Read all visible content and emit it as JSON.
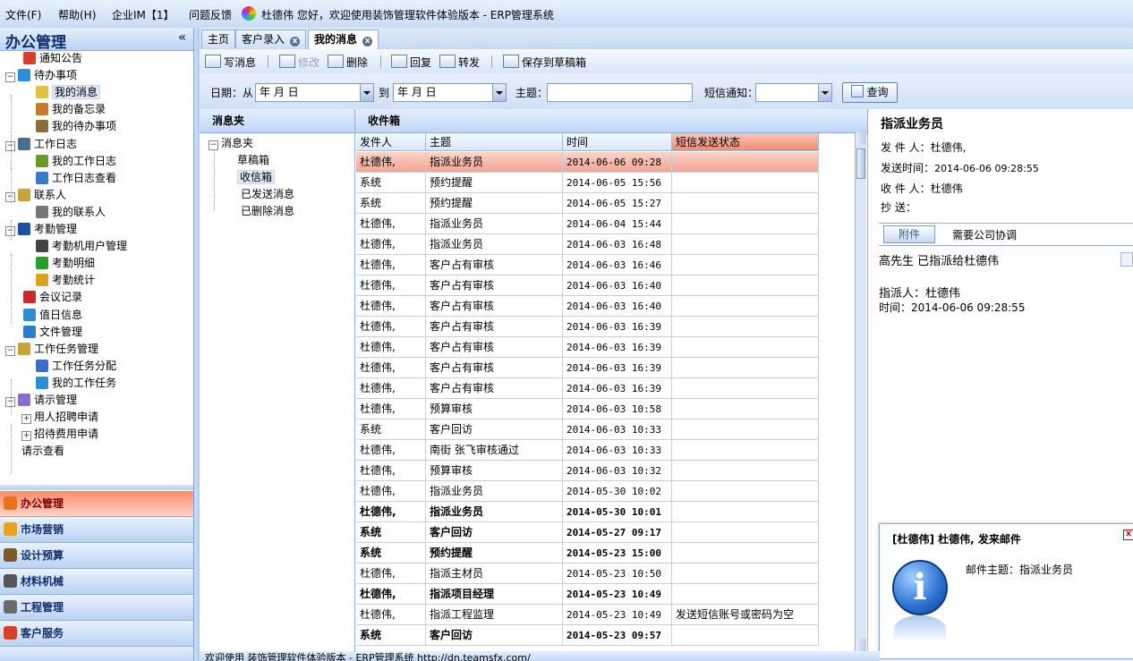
{
  "menu": {
    "file": "文件(F)",
    "help": "帮助(H)",
    "im": "企业IM【1】",
    "feedback": "问题反馈",
    "greeting": "杜德伟  您好，欢迎使用装饰管理软件体验版本 - ERP管理系统"
  },
  "left": {
    "title": "办公管理",
    "collapse": "«",
    "tree": [
      {
        "label": "通知公告",
        "icon": "mail-icon",
        "color": "#d9402b"
      },
      {
        "label": "待办事项",
        "icon": "cube-icon",
        "color": "#2a8fd6"
      },
      {
        "label": "我的消息",
        "icon": "message-icon",
        "color": "#e2c23c"
      },
      {
        "label": "我的备忘录",
        "icon": "memo-icon",
        "color": "#c77a2a"
      },
      {
        "label": "我的待办事项",
        "icon": "clock-icon",
        "color": "#8a6d3b"
      },
      {
        "label": "工作日志",
        "icon": "book-icon",
        "color": "#4d6f8f"
      },
      {
        "label": "我的工作日志",
        "icon": "pencil-icon",
        "color": "#6a9a2a"
      },
      {
        "label": "工作日志查看",
        "icon": "magnifier-icon",
        "color": "#3a7bc8"
      },
      {
        "label": "联系人",
        "icon": "contacts-icon",
        "color": "#c8a23a"
      },
      {
        "label": "我的联系人",
        "icon": "link-icon",
        "color": "#777777"
      },
      {
        "label": "考勤管理",
        "icon": "grid-icon",
        "color": "#1f4fa3"
      },
      {
        "label": "考勤机用户管理",
        "icon": "gear-icon",
        "color": "#444444"
      },
      {
        "label": "考勤明细",
        "icon": "dot-icon",
        "color": "#2a9a2a"
      },
      {
        "label": "考勤统计",
        "icon": "bars-icon",
        "color": "#d9a41f"
      },
      {
        "label": "会议记录",
        "icon": "record-icon",
        "color": "#c82a2a"
      },
      {
        "label": "值日信息",
        "icon": "plus-circle-icon",
        "color": "#2a8fd6"
      },
      {
        "label": "文件管理",
        "icon": "refresh-icon",
        "color": "#2a7fc8"
      },
      {
        "label": "工作任务管理",
        "icon": "calendar-icon",
        "color": "#c8a23a"
      },
      {
        "label": "工作任务分配",
        "icon": "task-icon",
        "color": "#3a6fc8"
      },
      {
        "label": "我的工作任务",
        "icon": "globe-icon",
        "color": "#2a8fd6"
      },
      {
        "label": "请示管理",
        "icon": "chat-icon",
        "color": "#8a6fc8"
      },
      {
        "label": "用人招聘申请",
        "icon": "",
        "color": ""
      },
      {
        "label": "招待费用申请",
        "icon": "",
        "color": ""
      },
      {
        "label": "请示查看",
        "icon": "",
        "color": ""
      }
    ],
    "nav": [
      {
        "label": "办公管理",
        "icon": "office-icon",
        "color": "#e8731f"
      },
      {
        "label": "市场营销",
        "icon": "marketing-icon",
        "color": "#e8a21f"
      },
      {
        "label": "设计预算",
        "icon": "design-icon",
        "color": "#7a5a2a"
      },
      {
        "label": "材料机械",
        "icon": "machine-icon",
        "color": "#555555"
      },
      {
        "label": "工程管理",
        "icon": "engineering-icon",
        "color": "#6a6a6a"
      },
      {
        "label": "客户服务",
        "icon": "service-icon",
        "color": "#d9402b"
      }
    ]
  },
  "tabs": [
    {
      "label": "主页"
    },
    {
      "label": "客户录入"
    },
    {
      "label": "我的消息"
    }
  ],
  "toolbar": {
    "write": "写消息",
    "edit": "修改",
    "delete": "删除",
    "reply": "回复",
    "forward": "转发",
    "save_draft": "保存到草稿箱"
  },
  "filter": {
    "date_label": "日期：从",
    "date_from": "  年   月   日",
    "to_label": "到",
    "date_to": "  年   月   日",
    "subject_label": "主题：",
    "subject_value": "",
    "sms_label": "短信通知：",
    "sms_value": "",
    "query_button": "查询"
  },
  "folders": {
    "header": "消息夹",
    "root": "消息夹",
    "items": [
      "草稿箱",
      "收信箱",
      "已发送消息",
      "已删除消息"
    ]
  },
  "inbox": {
    "header": "收件箱",
    "columns": [
      "发件人",
      "主题",
      "时间",
      "短信发送状态"
    ],
    "rows": [
      {
        "sender": "杜德伟,",
        "subject": "指派业务员",
        "time": "2014-06-06 09:28",
        "sms": "",
        "bold": false,
        "highlight": true
      },
      {
        "sender": "系统",
        "subject": "预约提醒",
        "time": "2014-06-05 15:56",
        "sms": "",
        "bold": false,
        "highlight": false
      },
      {
        "sender": "系统",
        "subject": "预约提醒",
        "time": "2014-06-05 15:27",
        "sms": "",
        "bold": false,
        "highlight": false
      },
      {
        "sender": "杜德伟,",
        "subject": "指派业务员",
        "time": "2014-06-04 15:44",
        "sms": "",
        "bold": false,
        "highlight": false
      },
      {
        "sender": "杜德伟,",
        "subject": "指派业务员",
        "time": "2014-06-03 16:48",
        "sms": "",
        "bold": false,
        "highlight": false
      },
      {
        "sender": "杜德伟,",
        "subject": "客户占有审核",
        "time": "2014-06-03 16:46",
        "sms": "",
        "bold": false,
        "highlight": false
      },
      {
        "sender": "杜德伟,",
        "subject": "客户占有审核",
        "time": "2014-06-03 16:40",
        "sms": "",
        "bold": false,
        "highlight": false
      },
      {
        "sender": "杜德伟,",
        "subject": "客户占有审核",
        "time": "2014-06-03 16:40",
        "sms": "",
        "bold": false,
        "highlight": false
      },
      {
        "sender": "杜德伟,",
        "subject": "客户占有审核",
        "time": "2014-06-03 16:39",
        "sms": "",
        "bold": false,
        "highlight": false
      },
      {
        "sender": "杜德伟,",
        "subject": "客户占有审核",
        "time": "2014-06-03 16:39",
        "sms": "",
        "bold": false,
        "highlight": false
      },
      {
        "sender": "杜德伟,",
        "subject": "客户占有审核",
        "time": "2014-06-03 16:39",
        "sms": "",
        "bold": false,
        "highlight": false
      },
      {
        "sender": "杜德伟,",
        "subject": "客户占有审核",
        "time": "2014-06-03 16:39",
        "sms": "",
        "bold": false,
        "highlight": false
      },
      {
        "sender": "杜德伟,",
        "subject": "预算审核",
        "time": "2014-06-03 10:58",
        "sms": "",
        "bold": false,
        "highlight": false
      },
      {
        "sender": "系统",
        "subject": "客户回访",
        "time": "2014-06-03 10:33",
        "sms": "",
        "bold": false,
        "highlight": false
      },
      {
        "sender": "杜德伟,",
        "subject": "南街 张飞审核通过",
        "time": "2014-06-03 10:33",
        "sms": "",
        "bold": false,
        "highlight": false
      },
      {
        "sender": "杜德伟,",
        "subject": "预算审核",
        "time": "2014-06-03 10:32",
        "sms": "",
        "bold": false,
        "highlight": false
      },
      {
        "sender": "杜德伟,",
        "subject": "指派业务员",
        "time": "2014-05-30 10:02",
        "sms": "",
        "bold": false,
        "highlight": false
      },
      {
        "sender": "杜德伟,",
        "subject": "指派业务员",
        "time": "2014-05-30 10:01",
        "sms": "",
        "bold": true,
        "highlight": false
      },
      {
        "sender": "系统",
        "subject": "客户回访",
        "time": "2014-05-27 09:17",
        "sms": "",
        "bold": true,
        "highlight": false
      },
      {
        "sender": "系统",
        "subject": "预约提醒",
        "time": "2014-05-23 15:00",
        "sms": "",
        "bold": true,
        "highlight": false
      },
      {
        "sender": "杜德伟,",
        "subject": "指派主材员",
        "time": "2014-05-23 10:50",
        "sms": "",
        "bold": false,
        "highlight": false
      },
      {
        "sender": "杜德伟,",
        "subject": "指派项目经理",
        "time": "2014-05-23 10:49",
        "sms": "",
        "bold": true,
        "highlight": false
      },
      {
        "sender": "杜德伟,",
        "subject": "指派工程监理",
        "time": "2014-05-23 10:49",
        "sms": "发送短信账号或密码为空",
        "bold": false,
        "highlight": false
      },
      {
        "sender": "系统",
        "subject": "客户回访",
        "time": "2014-05-23 09:57",
        "sms": "",
        "bold": true,
        "highlight": false
      }
    ]
  },
  "detail": {
    "title": "指派业务员",
    "sender_label": "发 件 人：",
    "sender": "杜德伟,",
    "time_label": "发送时间：",
    "time": "2014-06-06 09:28:55",
    "receiver_label": "收 件 人：",
    "receiver": "杜德伟",
    "cc_label": "抄    送：",
    "cc": "",
    "attach_button": "附件",
    "note": "需要公司协调",
    "body_line1": "高先生 已指派给杜德伟",
    "body_line2": "指派人：杜德伟",
    "body_line3": "时间：2014-06-06 09:28:55"
  },
  "popup": {
    "title": "[杜德伟] 杜德伟, 发来邮件",
    "subject": "邮件主题：指派业务员",
    "icon": "info-icon",
    "close": "x"
  },
  "status": {
    "text": "欢迎使用 装饰管理软件体验版本 - ERP管理系统   http://dn.teamsfx.com/"
  },
  "colors": {
    "accent": "#c6d9f3",
    "highlight_row": "#f3a493",
    "active_nav": "#fb8a6e"
  }
}
